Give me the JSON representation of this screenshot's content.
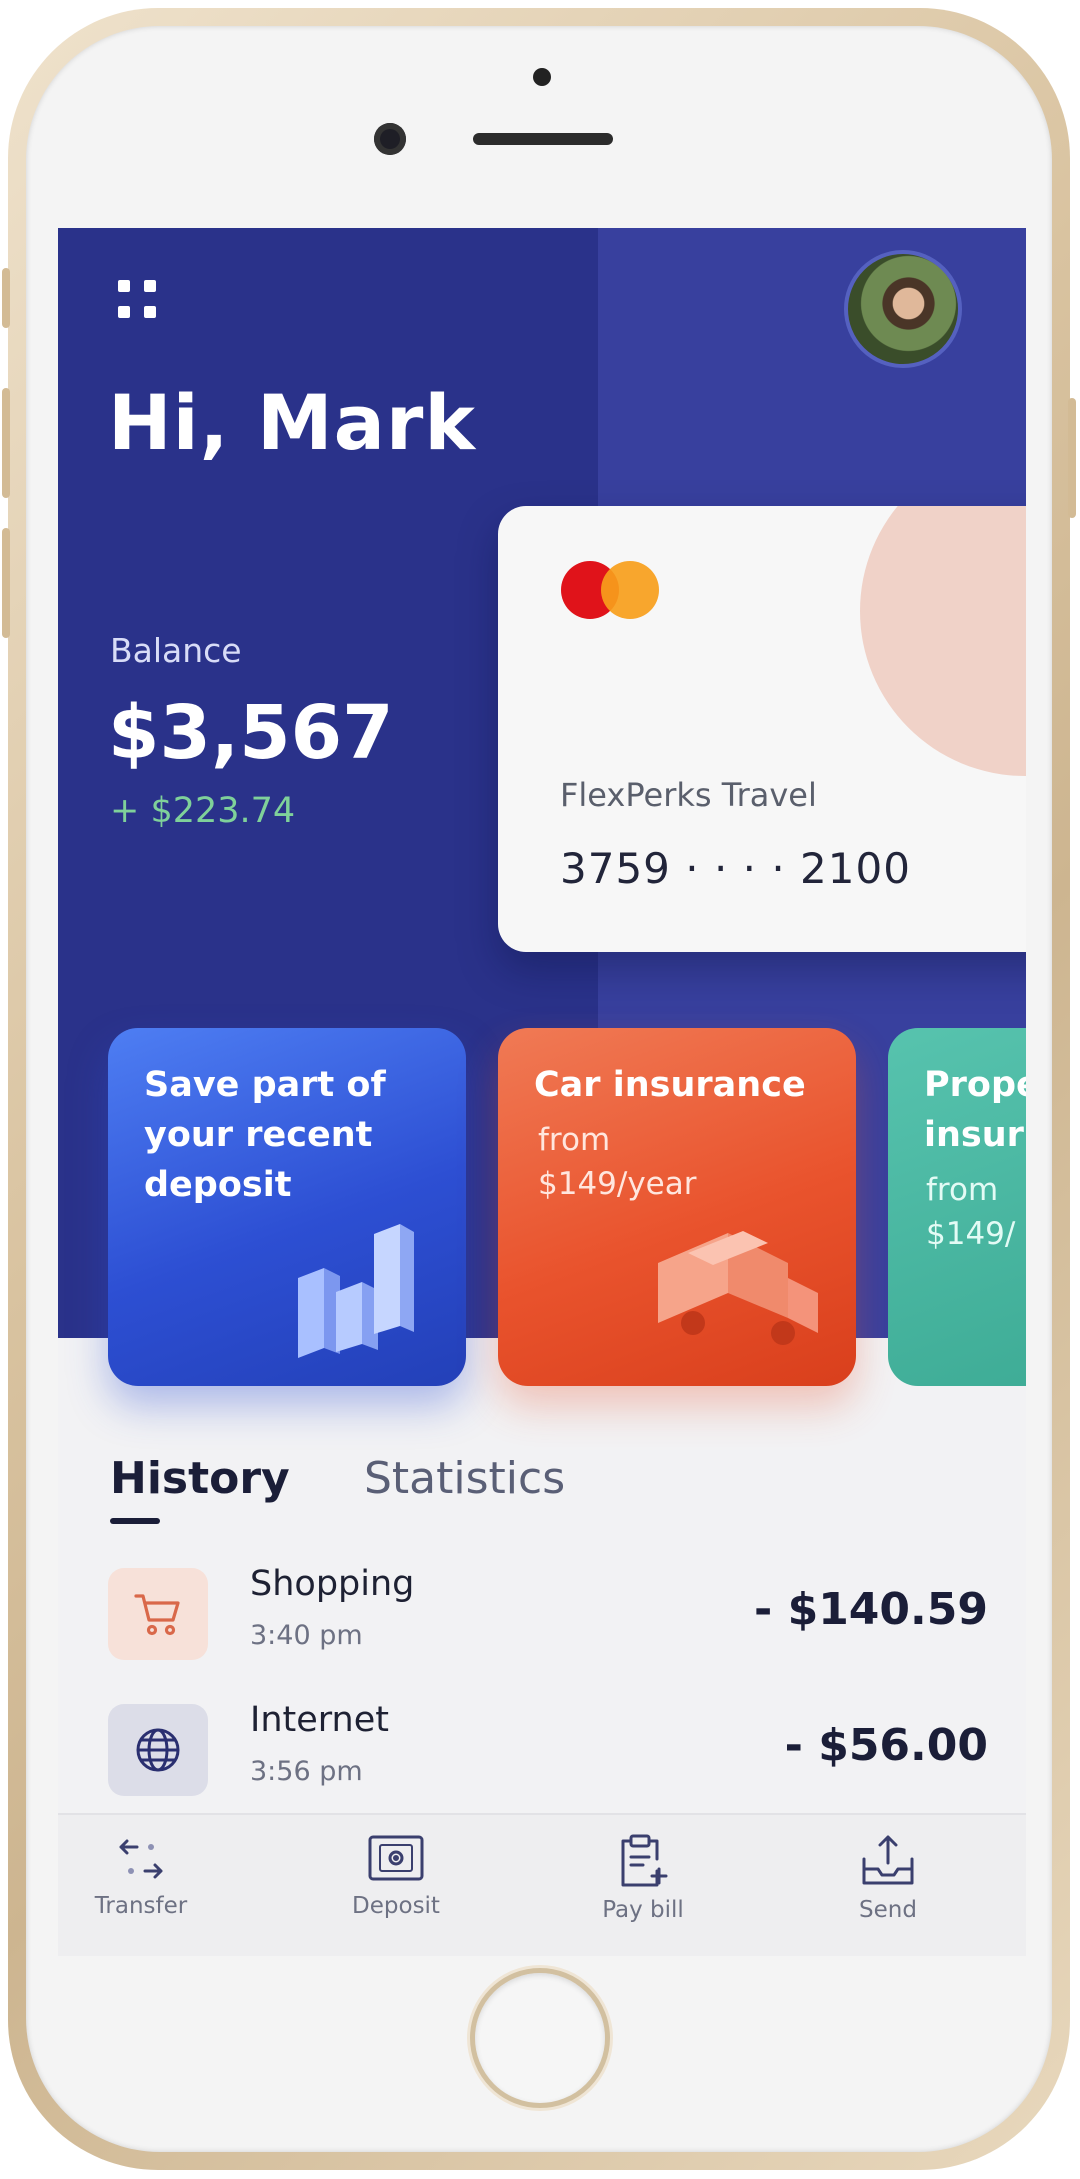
{
  "header": {
    "greeting": "Hi, Mark"
  },
  "balance": {
    "label": "Balance",
    "amount": "$3,567",
    "change": "+ $223.74"
  },
  "card": {
    "name": "FlexPerks Travel",
    "number": "3759 · · · · 2100",
    "brand_icon": "mastercard-logo"
  },
  "promos": [
    {
      "title": "Save part of your recent deposit",
      "subtitle": "",
      "icon": "bar-chart-icon"
    },
    {
      "title": "Car insurance",
      "subtitle_line1": "from",
      "subtitle_line2": "$149/year",
      "icon": "van-icon"
    },
    {
      "title": "Prope insur",
      "subtitle_line1": "from",
      "subtitle_line2": "$149/"
    }
  ],
  "tabs": [
    {
      "label": "History"
    },
    {
      "label": "Statistics"
    }
  ],
  "transactions": [
    {
      "name": "Shopping",
      "time": "3:40 pm",
      "amount": "- $140.59",
      "icon": "cart-icon"
    },
    {
      "name": "Internet",
      "time": "3:56 pm",
      "amount": "- $56.00",
      "icon": "globe-icon"
    }
  ],
  "nav": [
    {
      "label": "Transfer",
      "icon": "transfer-icon"
    },
    {
      "label": "Deposit",
      "icon": "safe-icon"
    },
    {
      "label": "Pay bill",
      "icon": "clipboard-icon"
    },
    {
      "label": "Send",
      "icon": "send-icon"
    }
  ],
  "colors": {
    "hero": "#2a328a",
    "accent_green": "#7fd19a",
    "tile_blue": "#2d4fd3",
    "tile_orange": "#e9532d",
    "tile_teal": "#3aa892"
  }
}
